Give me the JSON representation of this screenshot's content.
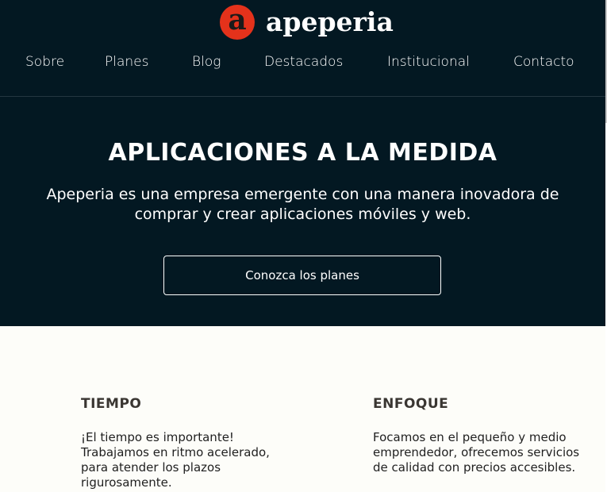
{
  "brand": {
    "mark": "a",
    "name": "apeperia",
    "accent_color": "#e4321b",
    "header_bg": "#031822"
  },
  "nav": {
    "items": [
      "Sobre",
      "Planes",
      "Blog",
      "Destacados",
      "Institucional",
      "Contacto"
    ]
  },
  "hero": {
    "title": "APLICACIONES A LA MEDIDA",
    "subtitle": "Apeperia es una empresa emergente con una manera inovadora de comprar y crear aplicaciones móviles y web.",
    "cta_label": "Conozca los planes"
  },
  "features": [
    {
      "title": "TIEMPO",
      "text": "¡El tiempo es importante! Trabajamos en ritmo acelerado, para atender los plazos rigurosamente."
    },
    {
      "title": "ENFOQUE",
      "text": "Focamos en el pequeño y medio emprendedor, ofrecemos servicios de calidad con precios accesibles."
    }
  ]
}
